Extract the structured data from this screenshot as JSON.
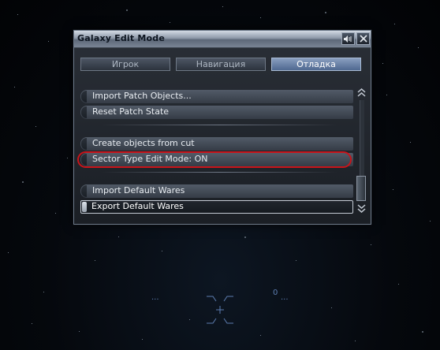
{
  "window": {
    "title": "Galaxy Edit Mode",
    "sound_icon": "speaker-icon",
    "close_icon": "close-icon"
  },
  "tabs": [
    {
      "label": "Игрок",
      "active": false
    },
    {
      "label": "Навигация",
      "active": false
    },
    {
      "label": "Отладка",
      "active": true
    }
  ],
  "menu": {
    "items": [
      {
        "label": "Import Patch Objects..."
      },
      {
        "label": "Reset Patch State"
      },
      {
        "label": "Create objects from cut"
      },
      {
        "label": "Sector Type Edit Mode: ON",
        "highlighted": true
      },
      {
        "label": "Import Default Wares"
      },
      {
        "label": "Export Default Wares",
        "selected": true
      }
    ]
  },
  "hud": {
    "counter": "0",
    "left_marker": "...",
    "right_marker": "..."
  },
  "colors": {
    "highlight_ring": "#c8141a",
    "active_tab": "#6f86ad",
    "hud": "#5d7db0"
  }
}
